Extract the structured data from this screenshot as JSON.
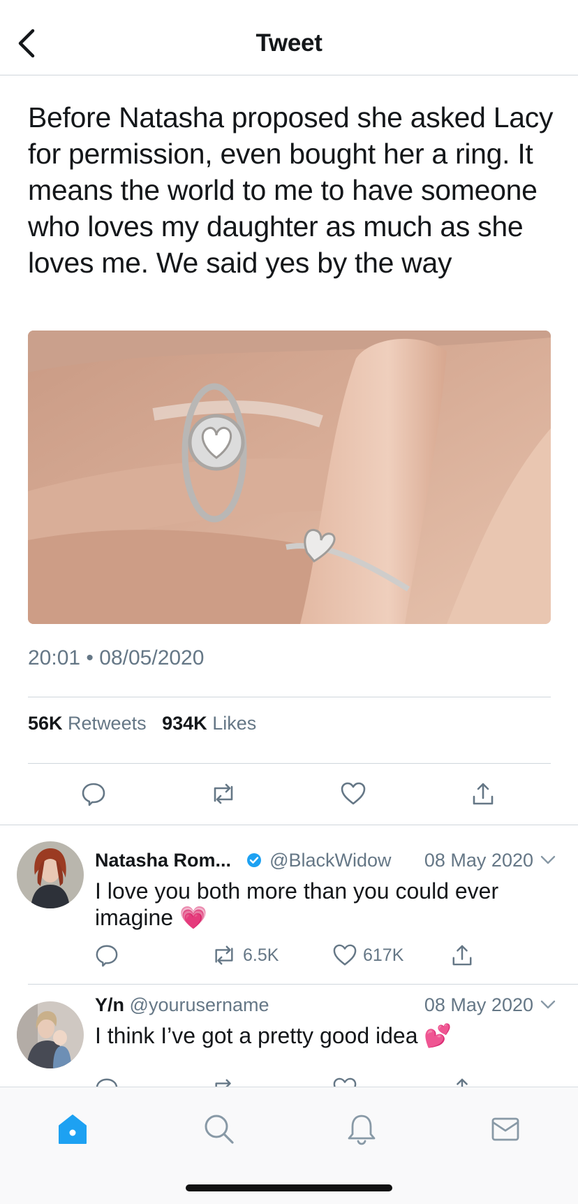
{
  "header": {
    "title": "Tweet",
    "back_icon": "chevron-left-icon"
  },
  "tweet": {
    "text": "Before Natasha proposed she asked Lacy for permission, even bought her a ring. It means the world to me to have someone who loves my daughter as much as she loves me. We said yes by the way",
    "time": "20:01",
    "separator": "•",
    "date": "08/05/2020",
    "retweets_count": "56K",
    "retweets_label": "Retweets",
    "likes_count": "934K",
    "likes_label": "Likes",
    "image_icon": "rings-on-hands-photo"
  },
  "replies": [
    {
      "name": "Natasha Rom...",
      "verified": true,
      "handle": "@BlackWidow",
      "date": "08 May 2020",
      "text": "I love you both more than you could ever imagine",
      "emoji": "💗",
      "retweets": "6.5K",
      "likes": "617K"
    },
    {
      "name": "Y/n",
      "handle": "@yourusername",
      "date": "08 May 2020",
      "text": "I think I’ve got a pretty good idea",
      "emoji": "💕"
    }
  ],
  "tabs": [
    "home-icon",
    "search-icon",
    "notifications-icon",
    "messages-icon"
  ],
  "colors": {
    "accent": "#1da1f2",
    "muted": "#657786",
    "text": "#14171a",
    "divider": "#cfd6dc"
  }
}
